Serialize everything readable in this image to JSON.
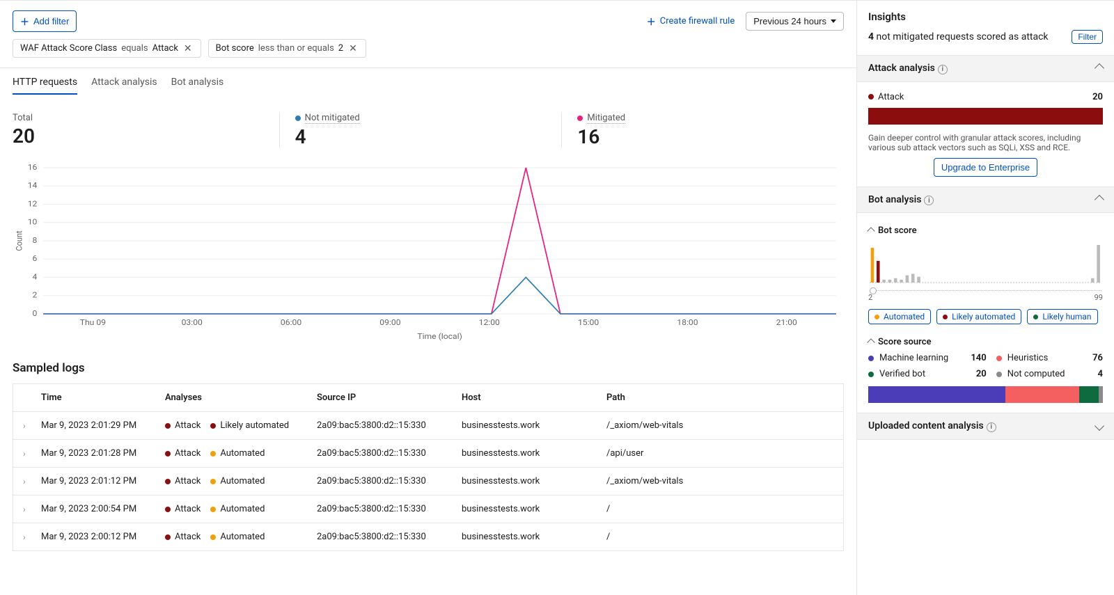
{
  "toolbar": {
    "add_filter": "Add filter",
    "create_rule": "Create firewall rule",
    "period": "Previous 24 hours"
  },
  "chips": [
    {
      "field": "WAF Attack Score Class",
      "op": "equals",
      "value": "Attack"
    },
    {
      "field": "Bot score",
      "op": "less than or equals",
      "value": "2"
    }
  ],
  "tabs": [
    "HTTP requests",
    "Attack analysis",
    "Bot analysis"
  ],
  "active_tab": 0,
  "totals": {
    "total": {
      "label": "Total",
      "value": "20"
    },
    "not_mitigated": {
      "label": "Not mitigated",
      "value": "4",
      "color": "#2c7cb0"
    },
    "mitigated": {
      "label": "Mitigated",
      "value": "16",
      "color": "#eb1e7f"
    }
  },
  "chart_data": {
    "type": "line",
    "xlabel": "Time (local)",
    "ylabel": "Count",
    "ylim": [
      0,
      16
    ],
    "x_ticks": [
      "Thu 09",
      "03:00",
      "06:00",
      "09:00",
      "12:00",
      "15:00",
      "18:00",
      "21:00"
    ],
    "y_ticks": [
      0,
      2,
      4,
      6,
      8,
      10,
      12,
      14,
      16
    ],
    "series": [
      {
        "name": "Mitigated",
        "color": "#eb1e7f",
        "values": [
          0,
          0,
          0,
          0,
          0,
          0,
          0,
          0,
          0,
          0,
          0,
          0,
          0,
          0,
          16,
          0,
          0,
          0,
          0,
          0,
          0,
          0,
          0,
          0
        ]
      },
      {
        "name": "Not mitigated",
        "color": "#2c7cb0",
        "values": [
          0,
          0,
          0,
          0,
          0,
          0,
          0,
          0,
          0,
          0,
          0,
          0,
          0,
          0,
          4,
          0,
          0,
          0,
          0,
          0,
          0,
          0,
          0,
          0
        ]
      }
    ]
  },
  "logs": {
    "title": "Sampled logs",
    "headers": {
      "time": "Time",
      "analyses": "Analyses",
      "ip": "Source IP",
      "host": "Host",
      "path": "Path"
    },
    "rows": [
      {
        "time": "Mar 9, 2023 2:01:29 PM",
        "attack": "Attack",
        "bot": "Likely automated",
        "bot_color": "#8c0d0d",
        "ip": "2a09:bac5:3800:d2::15:330",
        "host": "businesstests.work",
        "path": "/_axiom/web-vitals"
      },
      {
        "time": "Mar 9, 2023 2:01:28 PM",
        "attack": "Attack",
        "bot": "Automated",
        "bot_color": "#f59e0b",
        "ip": "2a09:bac5:3800:d2::15:330",
        "host": "businesstests.work",
        "path": "/api/user"
      },
      {
        "time": "Mar 9, 2023 2:01:12 PM",
        "attack": "Attack",
        "bot": "Automated",
        "bot_color": "#f59e0b",
        "ip": "2a09:bac5:3800:d2::15:330",
        "host": "businesstests.work",
        "path": "/_axiom/web-vitals"
      },
      {
        "time": "Mar 9, 2023 2:00:54 PM",
        "attack": "Attack",
        "bot": "Automated",
        "bot_color": "#f59e0b",
        "ip": "2a09:bac5:3800:d2::15:330",
        "host": "businesstests.work",
        "path": "/"
      },
      {
        "time": "Mar 9, 2023 2:00:12 PM",
        "attack": "Attack",
        "bot": "Automated",
        "bot_color": "#f59e0b",
        "ip": "2a09:bac5:3800:d2::15:330",
        "host": "businesstests.work",
        "path": "/"
      }
    ]
  },
  "sidebar": {
    "insights_title": "Insights",
    "insight": {
      "count": "4",
      "text": "not mitigated requests scored as attack",
      "filter": "Filter"
    },
    "attack": {
      "title": "Attack analysis",
      "legend": "Attack",
      "value": "20",
      "upgrade_text": "Gain deeper control with granular attack scores, including various sub attack vectors such as SQLi, XSS and RCE.",
      "upgrade_btn": "Upgrade to Enterprise"
    },
    "bot": {
      "title": "Bot analysis",
      "botscore_title": "Bot score",
      "slider": {
        "min": "2",
        "max": "99"
      },
      "tags": [
        {
          "label": "Automated",
          "color": "#f59e0b"
        },
        {
          "label": "Likely automated",
          "color": "#8c0d0d"
        },
        {
          "label": "Likely human",
          "color": "#0d6b3f"
        }
      ],
      "mini": {
        "bars": [
          48,
          30,
          4,
          4,
          6,
          4,
          10,
          12,
          8,
          0,
          0,
          0,
          0,
          0,
          0,
          0,
          0,
          0,
          0,
          0,
          0,
          0,
          0,
          0,
          0,
          0,
          0,
          0,
          0,
          0,
          0,
          0,
          0,
          0,
          0,
          0,
          0,
          0,
          6,
          52
        ],
        "accent_index": 0,
        "accent_color": "#f59e0b",
        "secondary_color": "#8c0d0d"
      },
      "score_source": {
        "title": "Score source",
        "items": [
          {
            "label": "Machine learning",
            "value": "140",
            "color": "#4b3db8"
          },
          {
            "label": "Heuristics",
            "value": "76",
            "color": "#f46060"
          },
          {
            "label": "Verified bot",
            "value": "20",
            "color": "#0d6b3f"
          },
          {
            "label": "Not computed",
            "value": "4",
            "color": "#8a8a8a"
          }
        ]
      }
    },
    "uploaded": {
      "title": "Uploaded content analysis"
    }
  }
}
